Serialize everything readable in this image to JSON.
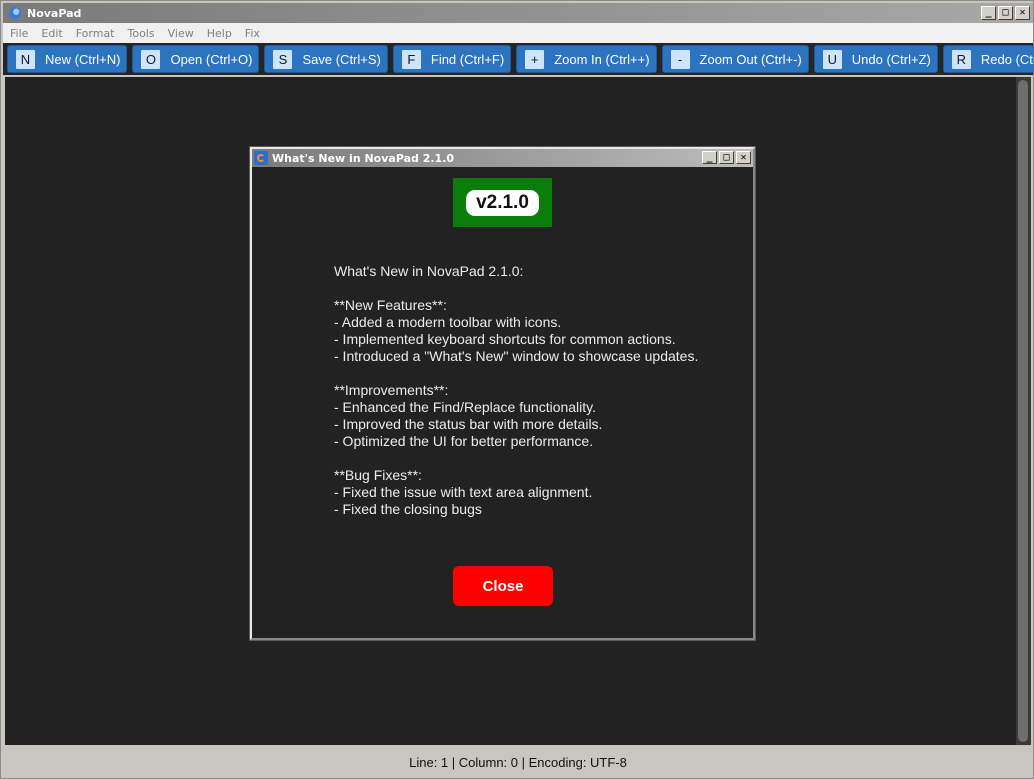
{
  "window": {
    "title": "NovaPad",
    "controls": {
      "minimize": "_",
      "maximize": "□",
      "close": "✕"
    }
  },
  "menubar": {
    "items": [
      {
        "label": "File"
      },
      {
        "label": "Edit"
      },
      {
        "label": "Format"
      },
      {
        "label": "Tools"
      },
      {
        "label": "View"
      },
      {
        "label": "Help"
      },
      {
        "label": "Fix"
      }
    ]
  },
  "toolbar": {
    "buttons": [
      {
        "key": "N",
        "label": "New (Ctrl+N)"
      },
      {
        "key": "O",
        "label": "Open (Ctrl+O)"
      },
      {
        "key": "S",
        "label": "Save (Ctrl+S)"
      },
      {
        "key": "F",
        "label": "Find (Ctrl+F)"
      },
      {
        "key": "+",
        "label": "Zoom In (Ctrl++)"
      },
      {
        "key": "-",
        "label": "Zoom Out (Ctrl+-)"
      },
      {
        "key": "U",
        "label": "Undo (Ctrl+Z)"
      },
      {
        "key": "R",
        "label": "Redo (Ctrl+Y)"
      }
    ]
  },
  "dialog": {
    "title": "What's New in NovaPad 2.1.0",
    "version_badge": "v2.1.0",
    "notes": [
      "What's New in NovaPad 2.1.0:",
      "",
      "**New Features**:",
      "- Added a modern toolbar with icons.",
      "- Implemented keyboard shortcuts for common actions.",
      "- Introduced a \"What's New\" window to showcase updates.",
      "",
      "**Improvements**:",
      "- Enhanced the Find/Replace functionality.",
      "- Improved the status bar with more details.",
      "- Optimized the UI for better performance.",
      "",
      "**Bug Fixes**:",
      "- Fixed the issue with text area alignment.",
      "- Fixed the closing bugs"
    ],
    "close_label": "Close",
    "controls": {
      "minimize": "_",
      "maximize": "□",
      "close": "✕"
    }
  },
  "statusbar": {
    "text": "Line: 1 | Column: 0 | Encoding: UTF-8"
  },
  "colors": {
    "toolbar_button": "#2c74c0",
    "editor_background": "#222222",
    "version_badge": "#0a7d0a",
    "close_button": "#ff0000"
  }
}
